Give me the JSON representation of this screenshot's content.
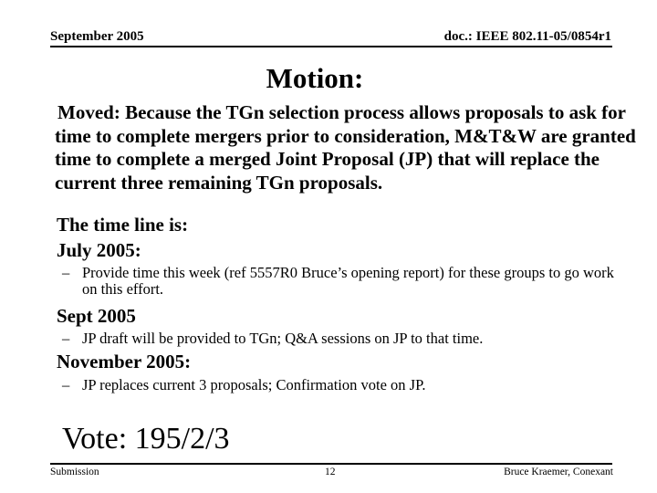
{
  "header": {
    "date": "September 2005",
    "doc_id": "doc.: IEEE 802.11-05/0854r1"
  },
  "slide": {
    "title": "Motion:",
    "moved_text": "Moved: Because the TGn selection process allows proposals to ask for time to complete mergers prior to consideration, M&T&W are granted time to complete a merged Joint Proposal (JP) that will replace the current three remaining TGn proposals.",
    "timeline_intro": "The time line is:",
    "milestones": [
      {
        "heading": "July 2005:",
        "detail": "Provide time this week (ref 5557R0 Bruce’s opening report) for these groups to go work on this effort."
      },
      {
        "heading": "Sept 2005",
        "detail": "JP draft will be provided to TGn; Q&A sessions on JP to that time."
      },
      {
        "heading": "November 2005:",
        "detail": "JP replaces current 3 proposals; Confirmation vote on JP."
      }
    ],
    "bullet_glyph": "–",
    "vote": "Vote: 195/2/3"
  },
  "footer": {
    "left": "Submission",
    "page_number": "12",
    "author": "Bruce Kraemer, Conexant"
  }
}
